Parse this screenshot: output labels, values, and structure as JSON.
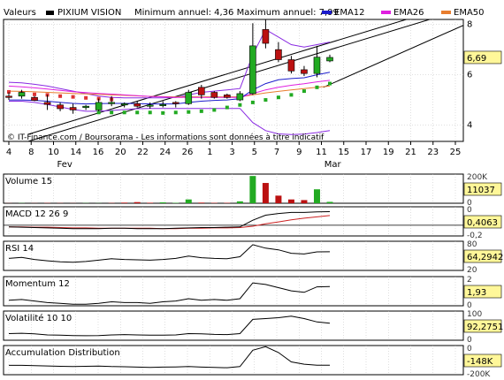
{
  "header": {
    "valeurs_label": "Valeurs",
    "stock_name": "PIXIUM VISION",
    "range_text": "Minimum annuel: 4,36 Maximum annuel: 7,99",
    "legend": [
      {
        "name": "EMA12",
        "color": "#1c1ccc"
      },
      {
        "name": "EMA26",
        "color": "#e020e0"
      },
      {
        "name": "EMA50",
        "color": "#e87d2e"
      }
    ]
  },
  "watermark": "© IT-Finance.com / Boursorama - Les informations sont données à titre indicatif",
  "colors": {
    "up": "#22aa22",
    "down": "#bb1111",
    "grid": "#bfbfbf",
    "axis_box": "#fff799",
    "indicator": "#000000"
  },
  "chart_data": [
    {
      "type": "candlestick",
      "title": "PIXIUM VISION",
      "x_tick_labels": [
        "4",
        "8",
        "10",
        "14",
        "16",
        "20",
        "22",
        "24",
        "26",
        "1",
        "3",
        "5",
        "7",
        "9",
        "11",
        "15",
        "17",
        "19",
        "21",
        "23",
        "25"
      ],
      "month_labels": [
        {
          "label": "Fev",
          "after_tick": "10"
        },
        {
          "label": "Mar",
          "after_tick": "11"
        }
      ],
      "y_ticks": [
        4,
        6,
        8
      ],
      "ylim": [
        3.35,
        8.2
      ],
      "last_value": "6,69",
      "candles": [
        {
          "o": 5.15,
          "h": 5.3,
          "l": 5.0,
          "c": 5.1
        },
        {
          "o": 5.15,
          "h": 5.4,
          "l": 5.05,
          "c": 5.3
        },
        {
          "o": 5.1,
          "h": 5.15,
          "l": 4.95,
          "c": 4.98
        },
        {
          "o": 4.9,
          "h": 5.2,
          "l": 4.6,
          "c": 4.82
        },
        {
          "o": 4.8,
          "h": 4.9,
          "l": 4.55,
          "c": 4.65
        },
        {
          "o": 4.7,
          "h": 4.85,
          "l": 4.45,
          "c": 4.6
        },
        {
          "o": 4.7,
          "h": 4.8,
          "l": 4.6,
          "c": 4.75
        },
        {
          "o": 4.6,
          "h": 5.05,
          "l": 4.55,
          "c": 4.9
        },
        {
          "o": 4.85,
          "h": 5.15,
          "l": 4.75,
          "c": 4.9
        },
        {
          "o": 4.8,
          "h": 4.9,
          "l": 4.7,
          "c": 4.85
        },
        {
          "o": 4.85,
          "h": 4.95,
          "l": 4.7,
          "c": 4.75
        },
        {
          "o": 4.78,
          "h": 4.9,
          "l": 4.65,
          "c": 4.8
        },
        {
          "o": 4.8,
          "h": 4.95,
          "l": 4.7,
          "c": 4.82
        },
        {
          "o": 4.9,
          "h": 4.95,
          "l": 4.7,
          "c": 4.85
        },
        {
          "o": 4.85,
          "h": 5.4,
          "l": 4.8,
          "c": 5.3
        },
        {
          "o": 5.5,
          "h": 5.6,
          "l": 5.05,
          "c": 5.2
        },
        {
          "o": 5.3,
          "h": 5.35,
          "l": 5.05,
          "c": 5.1
        },
        {
          "o": 5.2,
          "h": 5.25,
          "l": 5.05,
          "c": 5.1
        },
        {
          "o": 5.0,
          "h": 5.35,
          "l": 4.95,
          "c": 5.25
        },
        {
          "o": 5.25,
          "h": 8.05,
          "l": 5.2,
          "c": 7.15
        },
        {
          "o": 7.8,
          "h": 8.2,
          "l": 7.05,
          "c": 7.25
        },
        {
          "o": 7.0,
          "h": 7.3,
          "l": 6.5,
          "c": 6.6
        },
        {
          "o": 6.6,
          "h": 6.75,
          "l": 6.05,
          "c": 6.15
        },
        {
          "o": 6.2,
          "h": 6.35,
          "l": 5.95,
          "c": 6.05
        },
        {
          "o": 6.05,
          "h": 7.15,
          "l": 5.9,
          "c": 6.7
        },
        {
          "o": 6.55,
          "h": 6.8,
          "l": 6.5,
          "c": 6.69
        }
      ],
      "ema12": [
        5.0,
        5.0,
        4.98,
        4.95,
        4.9,
        4.86,
        4.84,
        4.85,
        4.86,
        4.86,
        4.85,
        4.84,
        4.84,
        4.84,
        4.9,
        4.95,
        4.98,
        5.0,
        5.05,
        5.4,
        5.65,
        5.8,
        5.85,
        5.88,
        6.0,
        6.1
      ],
      "ema26": [
        5.55,
        5.52,
        5.48,
        5.43,
        5.38,
        5.33,
        5.29,
        5.26,
        5.23,
        5.2,
        5.17,
        5.14,
        5.12,
        5.1,
        5.1,
        5.1,
        5.1,
        5.1,
        5.1,
        5.25,
        5.4,
        5.5,
        5.58,
        5.64,
        5.72,
        5.78
      ],
      "ema50": [
        5.35,
        5.34,
        5.32,
        5.3,
        5.28,
        5.26,
        5.24,
        5.22,
        5.2,
        5.18,
        5.16,
        5.14,
        5.13,
        5.12,
        5.12,
        5.12,
        5.12,
        5.12,
        5.12,
        5.2,
        5.28,
        5.34,
        5.4,
        5.45,
        5.5,
        5.55
      ],
      "bollinger_upper": [
        5.7,
        5.68,
        5.62,
        5.55,
        5.45,
        5.35,
        5.25,
        5.15,
        5.1,
        5.08,
        5.08,
        5.08,
        5.08,
        5.1,
        5.2,
        5.3,
        5.35,
        5.4,
        5.45,
        6.8,
        7.8,
        7.5,
        7.2,
        7.1,
        7.2,
        7.3
      ],
      "bollinger_lower": [
        4.95,
        4.95,
        4.9,
        4.82,
        4.72,
        4.62,
        4.55,
        4.55,
        4.58,
        4.62,
        4.65,
        4.66,
        4.66,
        4.66,
        4.66,
        4.66,
        4.66,
        4.66,
        4.66,
        4.1,
        3.78,
        3.65,
        3.62,
        3.64,
        3.7,
        3.78
      ],
      "green_dots": [
        4.5,
        4.5,
        4.5,
        4.5,
        4.5,
        4.48,
        4.5,
        4.52,
        4.55,
        4.6,
        4.7,
        4.8,
        4.9,
        5.0,
        5.1,
        5.2,
        5.35,
        5.5,
        5.65
      ],
      "red_dots": [
        5.32,
        5.28,
        5.22,
        5.2,
        5.15,
        5.12,
        5.08,
        5.05,
        5.02
      ],
      "trendlines": [
        {
          "from": [
            1.5,
            3.35
          ],
          "to": [
            36.0,
            8.7
          ]
        },
        {
          "from": [
            24.5,
            5.5
          ],
          "to": [
            36.0,
            8.1
          ]
        }
      ]
    },
    {
      "type": "bar",
      "title": "Volume 15",
      "last_value": "11037",
      "y_ticks": [
        "200K",
        "0"
      ],
      "ylim": [
        0,
        230000
      ],
      "values": [
        1000,
        1500,
        1000,
        2000,
        1500,
        1000,
        1500,
        1000,
        2000,
        5000,
        9000,
        4000,
        7000,
        3000,
        30000,
        5000,
        3000,
        3000,
        15000,
        215000,
        160000,
        60000,
        30000,
        25000,
        110000,
        11037
      ],
      "colors": [
        "down",
        "up",
        "down",
        "down",
        "down",
        "down",
        "up",
        "up",
        "down",
        "down",
        "down",
        "down",
        "up",
        "up",
        "up",
        "down",
        "down",
        "down",
        "up",
        "up",
        "down",
        "down",
        "down",
        "down",
        "up",
        "up"
      ]
    },
    {
      "type": "line",
      "title": "MACD 12 26 9",
      "last_value": "0,4063",
      "y_ticks": [
        "0",
        "-0,2"
      ],
      "ylim": [
        -0.32,
        0.55
      ],
      "series": [
        {
          "role": "macd",
          "values": [
            -0.05,
            -0.06,
            -0.07,
            -0.08,
            -0.09,
            -0.1,
            -0.1,
            -0.1,
            -0.09,
            -0.09,
            -0.1,
            -0.1,
            -0.1,
            -0.09,
            -0.08,
            -0.07,
            -0.07,
            -0.06,
            -0.05,
            0.15,
            0.3,
            0.35,
            0.38,
            0.38,
            0.4,
            0.4063
          ]
        },
        {
          "role": "signal",
          "values": [
            -0.05,
            -0.05,
            -0.06,
            -0.06,
            -0.07,
            -0.08,
            -0.08,
            -0.09,
            -0.09,
            -0.09,
            -0.09,
            -0.09,
            -0.1,
            -0.1,
            -0.09,
            -0.09,
            -0.08,
            -0.08,
            -0.07,
            -0.03,
            0.04,
            0.1,
            0.16,
            0.21,
            0.25,
            0.29
          ]
        }
      ]
    },
    {
      "type": "line",
      "title": "RSI 14",
      "last_value": "64,2942",
      "y_ticks": [
        "80",
        "20"
      ],
      "ylim": [
        10,
        95
      ],
      "values": [
        45,
        48,
        42,
        38,
        35,
        34,
        36,
        40,
        44,
        42,
        41,
        40,
        42,
        45,
        52,
        47,
        45,
        44,
        50,
        85,
        75,
        70,
        60,
        58,
        64,
        64.2942
      ]
    },
    {
      "type": "line",
      "title": "Momentum 12",
      "last_value": "1,93",
      "y_ticks": [
        "2",
        "0"
      ],
      "ylim": [
        -0.5,
        3.2
      ],
      "values": [
        0.2,
        0.3,
        0.1,
        -0.1,
        -0.2,
        -0.3,
        -0.3,
        -0.2,
        0.0,
        -0.1,
        -0.1,
        -0.2,
        0.0,
        0.1,
        0.4,
        0.2,
        0.3,
        0.2,
        0.4,
        2.4,
        2.2,
        1.8,
        1.4,
        1.2,
        1.9,
        1.93
      ]
    },
    {
      "type": "line",
      "title": "Volatilité 10 10",
      "last_value": "92,2751",
      "y_ticks": [
        "100",
        "0"
      ],
      "ylim": [
        -10,
        165
      ],
      "values": [
        30,
        32,
        28,
        22,
        20,
        18,
        17,
        18,
        22,
        24,
        22,
        20,
        20,
        22,
        30,
        28,
        25,
        24,
        30,
        115,
        120,
        125,
        135,
        120,
        100,
        92.2751
      ]
    },
    {
      "type": "line",
      "title": "Accumulation Distribution",
      "last_value": "-148K",
      "y_ticks": [
        "0",
        "-200K"
      ],
      "ylim": [
        -230000,
        20000
      ],
      "values": [
        -150000,
        -150000,
        -152000,
        -155000,
        -158000,
        -160000,
        -158000,
        -156000,
        -160000,
        -162000,
        -165000,
        -168000,
        -165000,
        -163000,
        -160000,
        -165000,
        -168000,
        -170000,
        -160000,
        -20000,
        10000,
        -40000,
        -120000,
        -140000,
        -148000,
        -148000
      ]
    }
  ]
}
